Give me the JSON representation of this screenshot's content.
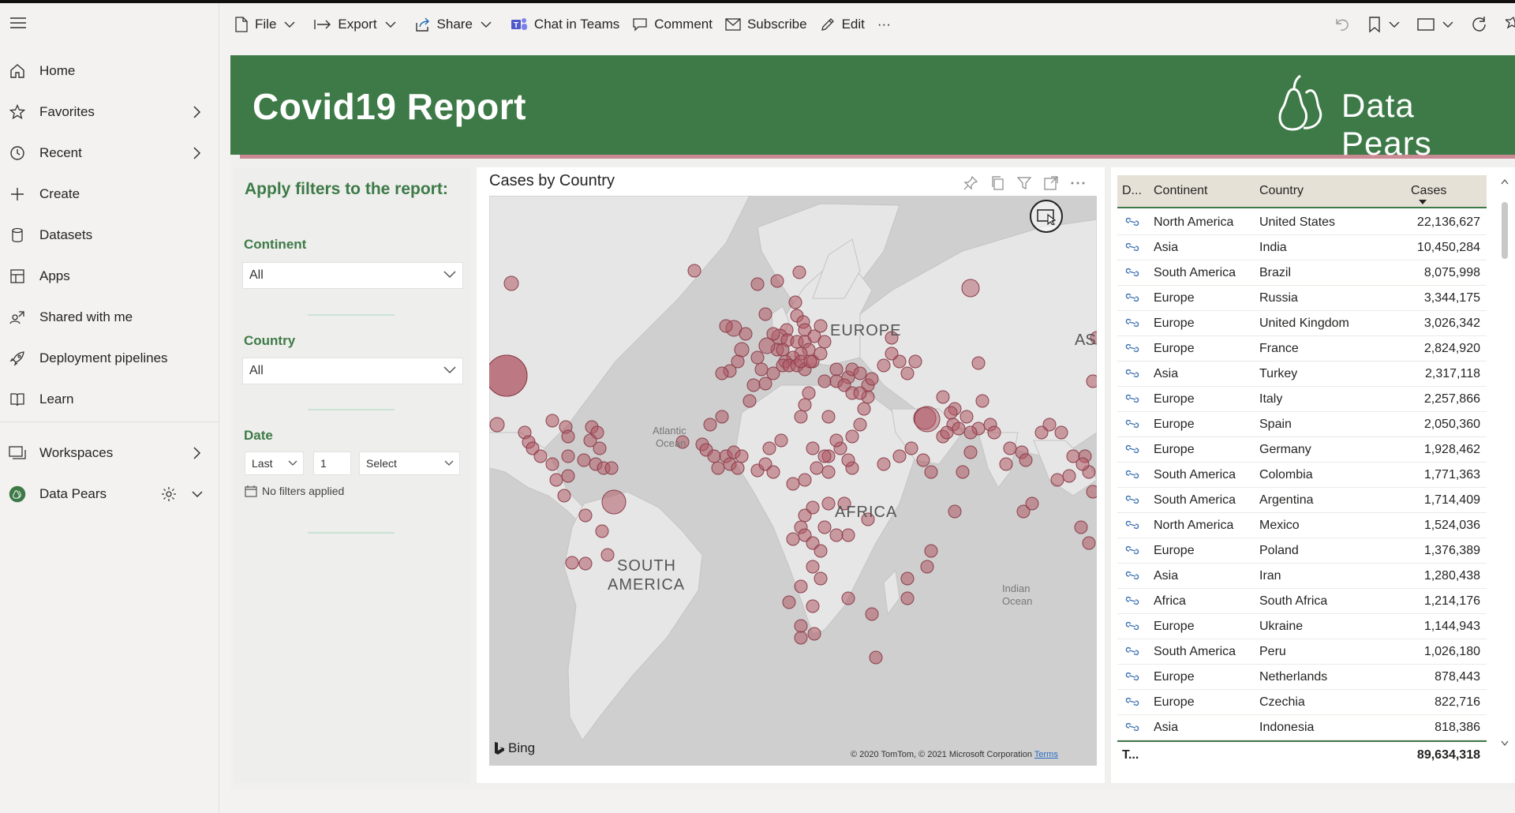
{
  "nav": {
    "items": [
      {
        "label": "Home"
      },
      {
        "label": "Favorites"
      },
      {
        "label": "Recent"
      },
      {
        "label": "Create"
      },
      {
        "label": "Datasets"
      },
      {
        "label": "Apps"
      },
      {
        "label": "Shared with me"
      },
      {
        "label": "Deployment pipelines"
      },
      {
        "label": "Learn"
      }
    ],
    "workspaces": "Workspaces",
    "current_workspace": "Data Pears"
  },
  "toolbar": {
    "file": "File",
    "export": "Export",
    "share": "Share",
    "chat": "Chat in Teams",
    "comment": "Comment",
    "subscribe": "Subscribe",
    "edit": "Edit",
    "more": "···"
  },
  "banner": {
    "title": "Covid19 Report",
    "brand": "Data Pears",
    "color": "#3d7a47"
  },
  "filters": {
    "title": "Apply filters to the report:",
    "continent_label": "Continent",
    "continent_value": "All",
    "country_label": "Country",
    "country_value": "All",
    "date_label": "Date",
    "date_mode": "Last",
    "date_count": "1",
    "date_unit": "Select",
    "no_filters": "No filters applied"
  },
  "map": {
    "title": "Cases by Country",
    "labels": {
      "europe": "EUROPE",
      "africa": "AFRICA",
      "south_america_1": "SOUTH",
      "south_america_2": "AMERICA",
      "asia": "AS",
      "atlantic_1": "Atlantic",
      "atlantic_2": "Ocean",
      "indian_1": "Indian",
      "indian_2": "Ocean"
    },
    "bing": "Bing",
    "copyright": "© 2020 TomTom, © 2021 Microsoft Corporation",
    "terms": "Terms",
    "bubble_color": "#b05a66"
  },
  "table": {
    "headers": {
      "d": "D...",
      "continent": "Continent",
      "country": "Country",
      "cases": "Cases"
    },
    "rows": [
      {
        "continent": "North America",
        "country": "United States",
        "cases": "22,136,627"
      },
      {
        "continent": "Asia",
        "country": "India",
        "cases": "10,450,284"
      },
      {
        "continent": "South America",
        "country": "Brazil",
        "cases": "8,075,998"
      },
      {
        "continent": "Europe",
        "country": "Russia",
        "cases": "3,344,175"
      },
      {
        "continent": "Europe",
        "country": "United Kingdom",
        "cases": "3,026,342"
      },
      {
        "continent": "Europe",
        "country": "France",
        "cases": "2,824,920"
      },
      {
        "continent": "Asia",
        "country": "Turkey",
        "cases": "2,317,118"
      },
      {
        "continent": "Europe",
        "country": "Italy",
        "cases": "2,257,866"
      },
      {
        "continent": "Europe",
        "country": "Spain",
        "cases": "2,050,360"
      },
      {
        "continent": "Europe",
        "country": "Germany",
        "cases": "1,928,462"
      },
      {
        "continent": "South America",
        "country": "Colombia",
        "cases": "1,771,363"
      },
      {
        "continent": "South America",
        "country": "Argentina",
        "cases": "1,714,409"
      },
      {
        "continent": "North America",
        "country": "Mexico",
        "cases": "1,524,036"
      },
      {
        "continent": "Europe",
        "country": "Poland",
        "cases": "1,376,389"
      },
      {
        "continent": "Asia",
        "country": "Iran",
        "cases": "1,280,438"
      },
      {
        "continent": "Africa",
        "country": "South Africa",
        "cases": "1,214,176"
      },
      {
        "continent": "Europe",
        "country": "Ukraine",
        "cases": "1,144,943"
      },
      {
        "continent": "South America",
        "country": "Peru",
        "cases": "1,026,180"
      },
      {
        "continent": "Europe",
        "country": "Netherlands",
        "cases": "878,443"
      },
      {
        "continent": "Europe",
        "country": "Czechia",
        "cases": "822,716"
      },
      {
        "continent": "Asia",
        "country": "Indonesia",
        "cases": "818,386"
      }
    ],
    "total_label": "T...",
    "total_value": "89,634,318"
  }
}
